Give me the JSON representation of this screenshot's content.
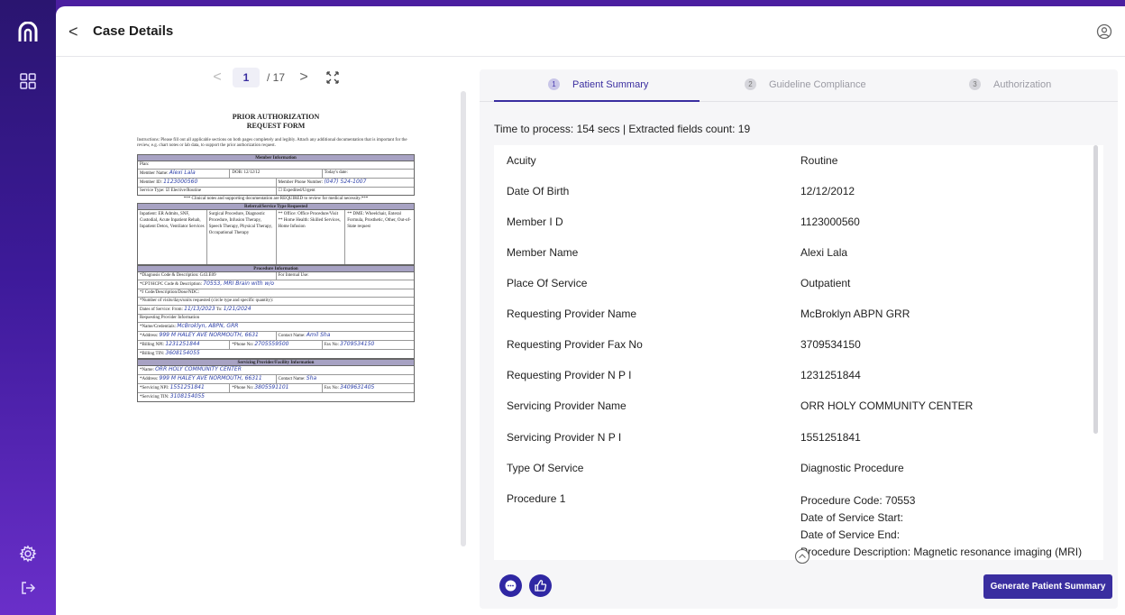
{
  "header": {
    "title": "Case Details",
    "back_glyph": "<",
    "icons": {
      "back": "chevron-left-icon",
      "user": "user-circle-icon"
    }
  },
  "sidebar": {
    "logo": "ꬸ",
    "items": [
      {
        "icon": "grid-icon"
      },
      {
        "icon": "gear-icon"
      },
      {
        "icon": "logout-icon"
      }
    ]
  },
  "viewer": {
    "pager": {
      "prev": "<",
      "current_page": "1",
      "total": "/ 17",
      "next": ">"
    },
    "form": {
      "title_line1": "PRIOR AUTHORIZATION",
      "title_line2": "REQUEST FORM",
      "instructions": "Instructions: Please fill out all applicable sections on both pages completely and legibly. Attach any additional documentation that is important for the review, e.g. chart notes or lab data, to support the prior authorization request.",
      "member_head": "Member Information",
      "plan_label": "Plan:",
      "member_name_label": "Member Name:",
      "member_name_value": "Alexi Lala",
      "dob_label": "DOB: 12/12/12",
      "today_label": "Today's date:",
      "member_id_label": "Member ID:",
      "member_id_value": "1123000560",
      "phone_label": "Member Phone Number:",
      "phone_value": "(047) 524-1007",
      "service_type_label": "Service Type:",
      "elective_label": "Elective/Routine",
      "expedited_label": "Expedited/Urgent",
      "clinical_note": "*** Clinical notes and supporting documentation are REQUIRED to review for medical necessity.***",
      "referral_head": "Referral/Service Type Requested",
      "inpatient_list": "Inpatient: ER Admits, SNF, Custodial, Acute Inpatient Rehab, Inpatient Detox, Ventilator Services",
      "outpatient_list": "Surgical Procedure, Diagnostic Procedure, Infusion Therapy, Speech Therapy, Physical Therapy, Occupational Therapy",
      "office_list": "** Office: Office Procedure/Visit  ** Home Health: Skilled Services, Home Infusion",
      "dme_list": "** DME: Wheelchair, Enteral Formula, Prosthetic, Other, Out-of-State request",
      "procedure_head": "Procedure Information",
      "diag_label": "*Diagnosis Code & Description:",
      "diag_value": "G43.E09",
      "internal_use": "For Internal Use:",
      "cpt_label": "*CPT/HCPC Code & Description:",
      "cpt_value": "70553, MRI Brain with w/o",
      "jcode_label": "*J Code/Description/Dose/NDC:",
      "visits_label": "*Number of visits/days/units requested (circle type and specific quantity):",
      "dates_label": "Dates of Service: From:",
      "dates_from": "11/13/2023",
      "dates_to_label": "To:",
      "dates_to": "1/21/2024",
      "req_prov_head": "Requesting Provider Information",
      "name_label": "*Name/Credentials:",
      "req_name_value": "McBroklyn, ABPN, GRR",
      "address_label": "*Address:",
      "req_address_value": "999 M HALEY AVE NORMOUTH, 6631",
      "contact_label": "Contact Name:",
      "req_contact_value": "Amil Sha",
      "billing_npi_label": "*Billing NPI:",
      "billing_npi_value": "1231251844",
      "phone_no_label": "*Phone No:",
      "req_phone_value": "2705559500",
      "fax_label": "Fax No:",
      "req_fax_value": "3709534150",
      "billing_tin_label": "*Billing TIN:",
      "billing_tin_value": "3608154055",
      "serv_head": "Servicing Provider/Facility Information",
      "serv_name_label": "*Name:",
      "serv_name_value": "ORR HOLY COMMUNITY CENTER",
      "serv_address_value": "999 M HALEY AVE NORMOUTH, 66311",
      "serv_contact_value": "Sha",
      "serv_npi_label": "*Servicing NPI:",
      "serv_npi_value": "1551251841",
      "serv_phone_value": "3805591101",
      "serv_fax_value": "3409631405",
      "serv_tin_label": "*Servicing TIN:",
      "serv_tin_value": "3108154055"
    }
  },
  "panel": {
    "tabs": [
      {
        "num": "1",
        "label": "Patient Summary",
        "active": true
      },
      {
        "num": "2",
        "label": "Guideline Compliance",
        "active": false
      },
      {
        "num": "3",
        "label": "Authorization",
        "active": false
      }
    ],
    "process_info": "Time to process: 154 secs | Extracted fields count: 19",
    "fields": [
      {
        "key": "Acuity",
        "value": "Routine"
      },
      {
        "key": "Date Of Birth",
        "value": "12/12/2012"
      },
      {
        "key": "Member I D",
        "value": "1123000560"
      },
      {
        "key": "Member Name",
        "value": "Alexi Lala"
      },
      {
        "key": "Place Of Service",
        "value": "Outpatient"
      },
      {
        "key": "Requesting Provider Name",
        "value": "McBroklyn ABPN GRR"
      },
      {
        "key": "Requesting Provider Fax No",
        "value": "3709534150"
      },
      {
        "key": "Requesting Provider N P I",
        "value": "1231251844"
      },
      {
        "key": "Servicing Provider Name",
        "value": "ORR HOLY COMMUNITY CENTER"
      },
      {
        "key": "Servicing Provider N P I",
        "value": "1551251841"
      },
      {
        "key": "Type Of Service",
        "value": "Diagnostic Procedure"
      }
    ],
    "procedure": {
      "key": "Procedure 1",
      "lines": [
        "Procedure Code: 70553",
        "Date of Service Start:",
        "Date of Service End:",
        "Procedure Description: Magnetic resonance imaging (MRI)"
      ]
    },
    "generate_label": "Generate Patient Summary"
  }
}
